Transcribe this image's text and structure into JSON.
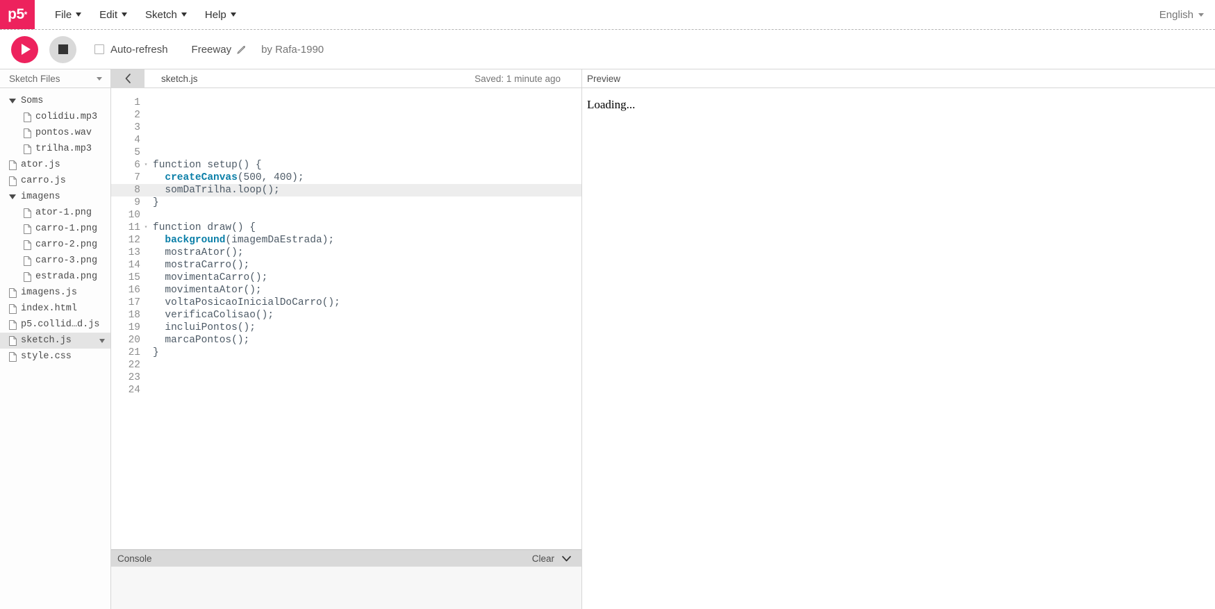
{
  "brand": {
    "logo_text": "p5",
    "logo_star": "*",
    "accent_color": "#ed225d"
  },
  "menubar": {
    "items": [
      {
        "label": "File",
        "icon": "chevron-down-icon"
      },
      {
        "label": "Edit",
        "icon": "chevron-down-icon"
      },
      {
        "label": "Sketch",
        "icon": "chevron-down-icon"
      },
      {
        "label": "Help",
        "icon": "chevron-down-icon"
      }
    ],
    "language": "English"
  },
  "toolbar": {
    "play_icon": "play-icon",
    "stop_icon": "stop-icon",
    "autorefresh_label": "Auto-refresh",
    "autorefresh_checked": false,
    "sketch_name": "Freeway",
    "rename_icon": "pencil-icon",
    "byline": "by Rafa-1990"
  },
  "sidebar": {
    "title": "Sketch Files",
    "collapse_icon": "chevron-down-icon",
    "files": [
      {
        "name": "Soms",
        "type": "folder",
        "indent": 0,
        "expanded": true,
        "selected": false
      },
      {
        "name": "colidiu.mp3",
        "type": "file",
        "indent": 1,
        "selected": false
      },
      {
        "name": "pontos.wav",
        "type": "file",
        "indent": 1,
        "selected": false
      },
      {
        "name": "trilha.mp3",
        "type": "file",
        "indent": 1,
        "selected": false
      },
      {
        "name": "ator.js",
        "type": "file",
        "indent": 0,
        "selected": false
      },
      {
        "name": "carro.js",
        "type": "file",
        "indent": 0,
        "selected": false
      },
      {
        "name": "imagens",
        "type": "folder",
        "indent": 0,
        "expanded": true,
        "selected": false
      },
      {
        "name": "ator-1.png",
        "type": "file",
        "indent": 1,
        "selected": false
      },
      {
        "name": "carro-1.png",
        "type": "file",
        "indent": 1,
        "selected": false
      },
      {
        "name": "carro-2.png",
        "type": "file",
        "indent": 1,
        "selected": false
      },
      {
        "name": "carro-3.png",
        "type": "file",
        "indent": 1,
        "selected": false
      },
      {
        "name": "estrada.png",
        "type": "file",
        "indent": 1,
        "selected": false
      },
      {
        "name": "imagens.js",
        "type": "file",
        "indent": 0,
        "selected": false
      },
      {
        "name": "index.html",
        "type": "file",
        "indent": 0,
        "selected": false
      },
      {
        "name": "p5.collid…d.js",
        "type": "file",
        "indent": 0,
        "selected": false
      },
      {
        "name": "sketch.js",
        "type": "file",
        "indent": 0,
        "selected": true,
        "menu_icon": "chevron-down-icon"
      },
      {
        "name": "style.css",
        "type": "file",
        "indent": 0,
        "selected": false
      }
    ]
  },
  "editor": {
    "collapse_icon": "chevron-left-icon",
    "tab_name": "sketch.js",
    "saved_status": "Saved: 1 minute ago",
    "active_line": 8,
    "code": [
      {
        "n": 1,
        "fold": "",
        "tokens": []
      },
      {
        "n": 2,
        "fold": "",
        "tokens": []
      },
      {
        "n": 3,
        "fold": "",
        "tokens": []
      },
      {
        "n": 4,
        "fold": "",
        "tokens": []
      },
      {
        "n": 5,
        "fold": "",
        "tokens": []
      },
      {
        "n": 6,
        "fold": "▾",
        "tokens": [
          {
            "t": "function setup() {",
            "c": "kw"
          }
        ]
      },
      {
        "n": 7,
        "fold": "",
        "tokens": [
          {
            "t": "  ",
            "c": "plain"
          },
          {
            "t": "createCanvas",
            "c": "fn"
          },
          {
            "t": "(500, 400);",
            "c": "plain"
          }
        ]
      },
      {
        "n": 8,
        "fold": "",
        "tokens": [
          {
            "t": "  somDaTrilha.loop();",
            "c": "plain"
          }
        ]
      },
      {
        "n": 9,
        "fold": "",
        "tokens": [
          {
            "t": "}",
            "c": "plain"
          }
        ]
      },
      {
        "n": 10,
        "fold": "",
        "tokens": []
      },
      {
        "n": 11,
        "fold": "▾",
        "tokens": [
          {
            "t": "function draw() {",
            "c": "kw"
          }
        ]
      },
      {
        "n": 12,
        "fold": "",
        "tokens": [
          {
            "t": "  ",
            "c": "plain"
          },
          {
            "t": "background",
            "c": "fn"
          },
          {
            "t": "(imagemDaEstrada);",
            "c": "plain"
          }
        ]
      },
      {
        "n": 13,
        "fold": "",
        "tokens": [
          {
            "t": "  mostraAtor();",
            "c": "plain"
          }
        ]
      },
      {
        "n": 14,
        "fold": "",
        "tokens": [
          {
            "t": "  mostraCarro();",
            "c": "plain"
          }
        ]
      },
      {
        "n": 15,
        "fold": "",
        "tokens": [
          {
            "t": "  movimentaCarro();",
            "c": "plain"
          }
        ]
      },
      {
        "n": 16,
        "fold": "",
        "tokens": [
          {
            "t": "  movimentaAtor();",
            "c": "plain"
          }
        ]
      },
      {
        "n": 17,
        "fold": "",
        "tokens": [
          {
            "t": "  voltaPosicaoInicialDoCarro();",
            "c": "plain"
          }
        ]
      },
      {
        "n": 18,
        "fold": "",
        "tokens": [
          {
            "t": "  verificaColisao();",
            "c": "plain"
          }
        ]
      },
      {
        "n": 19,
        "fold": "",
        "tokens": [
          {
            "t": "  incluiPontos();",
            "c": "plain"
          }
        ]
      },
      {
        "n": 20,
        "fold": "",
        "tokens": [
          {
            "t": "  marcaPontos();",
            "c": "plain"
          }
        ]
      },
      {
        "n": 21,
        "fold": "",
        "tokens": [
          {
            "t": "}",
            "c": "plain"
          }
        ]
      },
      {
        "n": 22,
        "fold": "",
        "tokens": []
      },
      {
        "n": 23,
        "fold": "",
        "tokens": []
      },
      {
        "n": 24,
        "fold": "",
        "tokens": []
      }
    ]
  },
  "console": {
    "label": "Console",
    "clear_label": "Clear",
    "collapse_icon": "chevron-down-icon",
    "messages": []
  },
  "preview": {
    "label": "Preview",
    "status": "Loading..."
  }
}
